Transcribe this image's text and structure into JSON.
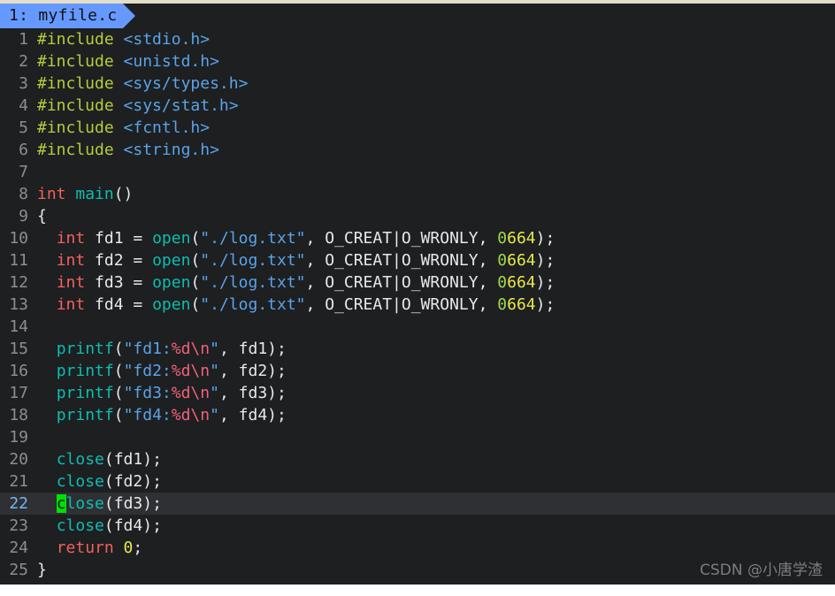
{
  "window": {
    "background_color": "#1d1f21",
    "top_border_color": "#e4ddc8",
    "current_line_bg": "#2e3033",
    "cursor_color": "#00e000"
  },
  "tabbar": {
    "tabs": [
      {
        "label": "1: myfile.c",
        "active": true,
        "color": "#6699ff"
      }
    ]
  },
  "editor": {
    "language": "c",
    "cursor": {
      "line": 22,
      "column": 3,
      "char": "c"
    },
    "current_line": 22,
    "lines": [
      {
        "num": "1",
        "tokens": [
          {
            "t": "#include ",
            "c": "tok-pre"
          },
          {
            "t": "<stdio.h>",
            "c": "tok-header"
          }
        ]
      },
      {
        "num": "2",
        "tokens": [
          {
            "t": "#include ",
            "c": "tok-pre"
          },
          {
            "t": "<unistd.h>",
            "c": "tok-header"
          }
        ]
      },
      {
        "num": "3",
        "tokens": [
          {
            "t": "#include ",
            "c": "tok-pre"
          },
          {
            "t": "<sys/types.h>",
            "c": "tok-header"
          }
        ]
      },
      {
        "num": "4",
        "tokens": [
          {
            "t": "#include ",
            "c": "tok-pre"
          },
          {
            "t": "<sys/stat.h>",
            "c": "tok-header"
          }
        ]
      },
      {
        "num": "5",
        "tokens": [
          {
            "t": "#include ",
            "c": "tok-pre"
          },
          {
            "t": "<fcntl.h>",
            "c": "tok-header"
          }
        ]
      },
      {
        "num": "6",
        "tokens": [
          {
            "t": "#include ",
            "c": "tok-pre"
          },
          {
            "t": "<string.h>",
            "c": "tok-header"
          }
        ]
      },
      {
        "num": "7",
        "tokens": []
      },
      {
        "num": "8",
        "tokens": [
          {
            "t": "int ",
            "c": "tok-type"
          },
          {
            "t": "main",
            "c": "tok-func"
          },
          {
            "t": "()",
            "c": "tok-punct"
          }
        ]
      },
      {
        "num": "9",
        "tokens": [
          {
            "t": "{",
            "c": "tok-brace"
          }
        ]
      },
      {
        "num": "10",
        "tokens": [
          {
            "t": "  ",
            "c": "tok-plain"
          },
          {
            "t": "int ",
            "c": "tok-type"
          },
          {
            "t": "fd1 ",
            "c": "tok-plain"
          },
          {
            "t": "= ",
            "c": "tok-punct"
          },
          {
            "t": "open",
            "c": "tok-func"
          },
          {
            "t": "(",
            "c": "tok-punct"
          },
          {
            "t": "\"./log.txt\"",
            "c": "tok-str"
          },
          {
            "t": ", O_CREAT|O_WRONLY, ",
            "c": "tok-plain"
          },
          {
            "t": "0",
            "c": "tok-num-zero"
          },
          {
            "t": "664",
            "c": "tok-num"
          },
          {
            "t": ");",
            "c": "tok-punct"
          }
        ]
      },
      {
        "num": "11",
        "tokens": [
          {
            "t": "  ",
            "c": "tok-plain"
          },
          {
            "t": "int ",
            "c": "tok-type"
          },
          {
            "t": "fd2 ",
            "c": "tok-plain"
          },
          {
            "t": "= ",
            "c": "tok-punct"
          },
          {
            "t": "open",
            "c": "tok-func"
          },
          {
            "t": "(",
            "c": "tok-punct"
          },
          {
            "t": "\"./log.txt\"",
            "c": "tok-str"
          },
          {
            "t": ", O_CREAT|O_WRONLY, ",
            "c": "tok-plain"
          },
          {
            "t": "0",
            "c": "tok-num-zero"
          },
          {
            "t": "664",
            "c": "tok-num"
          },
          {
            "t": ");",
            "c": "tok-punct"
          }
        ]
      },
      {
        "num": "12",
        "tokens": [
          {
            "t": "  ",
            "c": "tok-plain"
          },
          {
            "t": "int ",
            "c": "tok-type"
          },
          {
            "t": "fd3 ",
            "c": "tok-plain"
          },
          {
            "t": "= ",
            "c": "tok-punct"
          },
          {
            "t": "open",
            "c": "tok-func"
          },
          {
            "t": "(",
            "c": "tok-punct"
          },
          {
            "t": "\"./log.txt\"",
            "c": "tok-str"
          },
          {
            "t": ", O_CREAT|O_WRONLY, ",
            "c": "tok-plain"
          },
          {
            "t": "0",
            "c": "tok-num-zero"
          },
          {
            "t": "664",
            "c": "tok-num"
          },
          {
            "t": ");",
            "c": "tok-punct"
          }
        ]
      },
      {
        "num": "13",
        "tokens": [
          {
            "t": "  ",
            "c": "tok-plain"
          },
          {
            "t": "int ",
            "c": "tok-type"
          },
          {
            "t": "fd4 ",
            "c": "tok-plain"
          },
          {
            "t": "= ",
            "c": "tok-punct"
          },
          {
            "t": "open",
            "c": "tok-func"
          },
          {
            "t": "(",
            "c": "tok-punct"
          },
          {
            "t": "\"./log.txt\"",
            "c": "tok-str"
          },
          {
            "t": ", O_CREAT|O_WRONLY, ",
            "c": "tok-plain"
          },
          {
            "t": "0",
            "c": "tok-num-zero"
          },
          {
            "t": "664",
            "c": "tok-num"
          },
          {
            "t": ");",
            "c": "tok-punct"
          }
        ]
      },
      {
        "num": "14",
        "tokens": []
      },
      {
        "num": "15",
        "tokens": [
          {
            "t": "  ",
            "c": "tok-plain"
          },
          {
            "t": "printf",
            "c": "tok-func"
          },
          {
            "t": "(",
            "c": "tok-punct"
          },
          {
            "t": "\"fd1:",
            "c": "tok-str"
          },
          {
            "t": "%d\\n",
            "c": "tok-fmt"
          },
          {
            "t": "\"",
            "c": "tok-str"
          },
          {
            "t": ", ",
            "c": "tok-punct"
          },
          {
            "t": "fd1",
            "c": "tok-plain"
          },
          {
            "t": ");",
            "c": "tok-punct"
          }
        ]
      },
      {
        "num": "16",
        "tokens": [
          {
            "t": "  ",
            "c": "tok-plain"
          },
          {
            "t": "printf",
            "c": "tok-func"
          },
          {
            "t": "(",
            "c": "tok-punct"
          },
          {
            "t": "\"fd2:",
            "c": "tok-str"
          },
          {
            "t": "%d\\n",
            "c": "tok-fmt"
          },
          {
            "t": "\"",
            "c": "tok-str"
          },
          {
            "t": ", ",
            "c": "tok-punct"
          },
          {
            "t": "fd2",
            "c": "tok-plain"
          },
          {
            "t": ");",
            "c": "tok-punct"
          }
        ]
      },
      {
        "num": "17",
        "tokens": [
          {
            "t": "  ",
            "c": "tok-plain"
          },
          {
            "t": "printf",
            "c": "tok-func"
          },
          {
            "t": "(",
            "c": "tok-punct"
          },
          {
            "t": "\"fd3:",
            "c": "tok-str"
          },
          {
            "t": "%d\\n",
            "c": "tok-fmt"
          },
          {
            "t": "\"",
            "c": "tok-str"
          },
          {
            "t": ", ",
            "c": "tok-punct"
          },
          {
            "t": "fd3",
            "c": "tok-plain"
          },
          {
            "t": ");",
            "c": "tok-punct"
          }
        ]
      },
      {
        "num": "18",
        "tokens": [
          {
            "t": "  ",
            "c": "tok-plain"
          },
          {
            "t": "printf",
            "c": "tok-func"
          },
          {
            "t": "(",
            "c": "tok-punct"
          },
          {
            "t": "\"fd4:",
            "c": "tok-str"
          },
          {
            "t": "%d\\n",
            "c": "tok-fmt"
          },
          {
            "t": "\"",
            "c": "tok-str"
          },
          {
            "t": ", ",
            "c": "tok-punct"
          },
          {
            "t": "fd4",
            "c": "tok-plain"
          },
          {
            "t": ");",
            "c": "tok-punct"
          }
        ]
      },
      {
        "num": "19",
        "tokens": []
      },
      {
        "num": "20",
        "tokens": [
          {
            "t": "  ",
            "c": "tok-plain"
          },
          {
            "t": "close",
            "c": "tok-func"
          },
          {
            "t": "(",
            "c": "tok-punct"
          },
          {
            "t": "fd1",
            "c": "tok-plain"
          },
          {
            "t": ");",
            "c": "tok-punct"
          }
        ]
      },
      {
        "num": "21",
        "tokens": [
          {
            "t": "  ",
            "c": "tok-plain"
          },
          {
            "t": "close",
            "c": "tok-func"
          },
          {
            "t": "(",
            "c": "tok-punct"
          },
          {
            "t": "fd2",
            "c": "tok-plain"
          },
          {
            "t": ");",
            "c": "tok-punct"
          }
        ]
      },
      {
        "num": "22",
        "current": true,
        "tokens": [
          {
            "t": "  ",
            "c": "tok-plain"
          },
          {
            "t": "c",
            "c": "tok-func cursor-block"
          },
          {
            "t": "lose",
            "c": "tok-func"
          },
          {
            "t": "(",
            "c": "tok-punct"
          },
          {
            "t": "fd3",
            "c": "tok-plain"
          },
          {
            "t": ");",
            "c": "tok-punct"
          }
        ]
      },
      {
        "num": "23",
        "tokens": [
          {
            "t": "  ",
            "c": "tok-plain"
          },
          {
            "t": "close",
            "c": "tok-func"
          },
          {
            "t": "(",
            "c": "tok-punct"
          },
          {
            "t": "fd4",
            "c": "tok-plain"
          },
          {
            "t": ");",
            "c": "tok-punct"
          }
        ]
      },
      {
        "num": "24",
        "tokens": [
          {
            "t": "  ",
            "c": "tok-plain"
          },
          {
            "t": "return ",
            "c": "tok-type"
          },
          {
            "t": "0",
            "c": "tok-num"
          },
          {
            "t": ";",
            "c": "tok-punct"
          }
        ]
      },
      {
        "num": "25",
        "tokens": [
          {
            "t": "}",
            "c": "tok-brace"
          }
        ]
      }
    ]
  },
  "watermark": {
    "text": "CSDN @小唐学渣"
  }
}
